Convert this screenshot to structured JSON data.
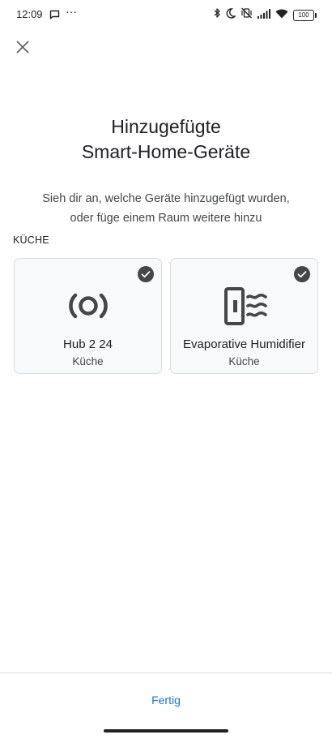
{
  "status_bar": {
    "time": "12:09",
    "dots": "···",
    "battery": "100",
    "icons": [
      "message-icon",
      "bluetooth-icon",
      "moon-icon",
      "vibrate-off-icon",
      "signal-icon",
      "wifi-icon",
      "battery-icon"
    ]
  },
  "header": {
    "close_icon": "close-icon",
    "title_line1": "Hinzugefügte",
    "title_line2": "Smart-Home-Geräte"
  },
  "subtitle": {
    "line1": "Sieh dir an, welche Geräte hinzugefügt wurden,",
    "line2": "oder füge einem Raum weitere hinzu"
  },
  "section": {
    "label": "KÜCHE"
  },
  "devices": [
    {
      "name": "Hub 2 24",
      "room": "Küche",
      "icon": "hub-icon",
      "selected": true
    },
    {
      "name": "Evaporative Humidifier",
      "room": "Küche",
      "icon": "humidifier-icon",
      "selected": true
    }
  ],
  "footer": {
    "done_label": "Fertig"
  },
  "colors": {
    "accent": "#1a73e8",
    "card_bg": "#f8f9fa",
    "icon": "#444746",
    "check": "#444746"
  }
}
